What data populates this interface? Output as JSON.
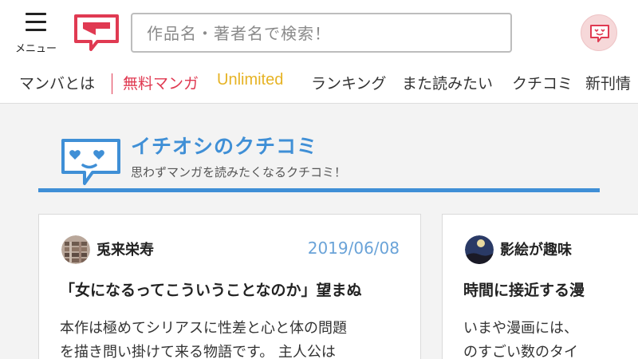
{
  "header": {
    "menu_label": "メニュー",
    "search": {
      "placeholder": "作品名・著者名で検索！"
    }
  },
  "nav": {
    "items": [
      {
        "label": "マンバとは",
        "color": "#333333"
      },
      {
        "label": "無料マンガ",
        "color": "#e03a52"
      },
      {
        "label": "Unlimited",
        "color": "#e6b325"
      },
      {
        "label": "ランキング",
        "color": "#333333"
      },
      {
        "label": "また読みたい",
        "color": "#333333"
      },
      {
        "label": "クチコミ",
        "color": "#333333"
      },
      {
        "label": "新刊情",
        "color": "#333333"
      }
    ]
  },
  "section": {
    "title": "イチオシのクチコミ",
    "subtitle": "思わずマンガを読みたくなるクチコミ！",
    "accent": "#3f8fd6"
  },
  "reviews": [
    {
      "user": "兎来栄寿",
      "date": "2019/06/08",
      "title": "「女になるってこういうことなのか」望まぬ",
      "body": [
        "本作は極めてシリアスに性差と心と体の問題",
        "を描き問い掛けて来る物語です。 主人公は"
      ]
    },
    {
      "user": "影絵が趣味",
      "date": "",
      "title": "時間に接近する漫",
      "body": [
        "いまや漫画には、",
        "のすごい数のタイ"
      ]
    }
  ],
  "colors": {
    "brand": "#e03a52",
    "link_blue": "#3f8fd6",
    "date": "#6aa3d8"
  },
  "icons": [
    "hamburger-menu-icon",
    "manba-logo",
    "mypage-face-icon",
    "speech-bubble-heart-eyes-icon"
  ]
}
